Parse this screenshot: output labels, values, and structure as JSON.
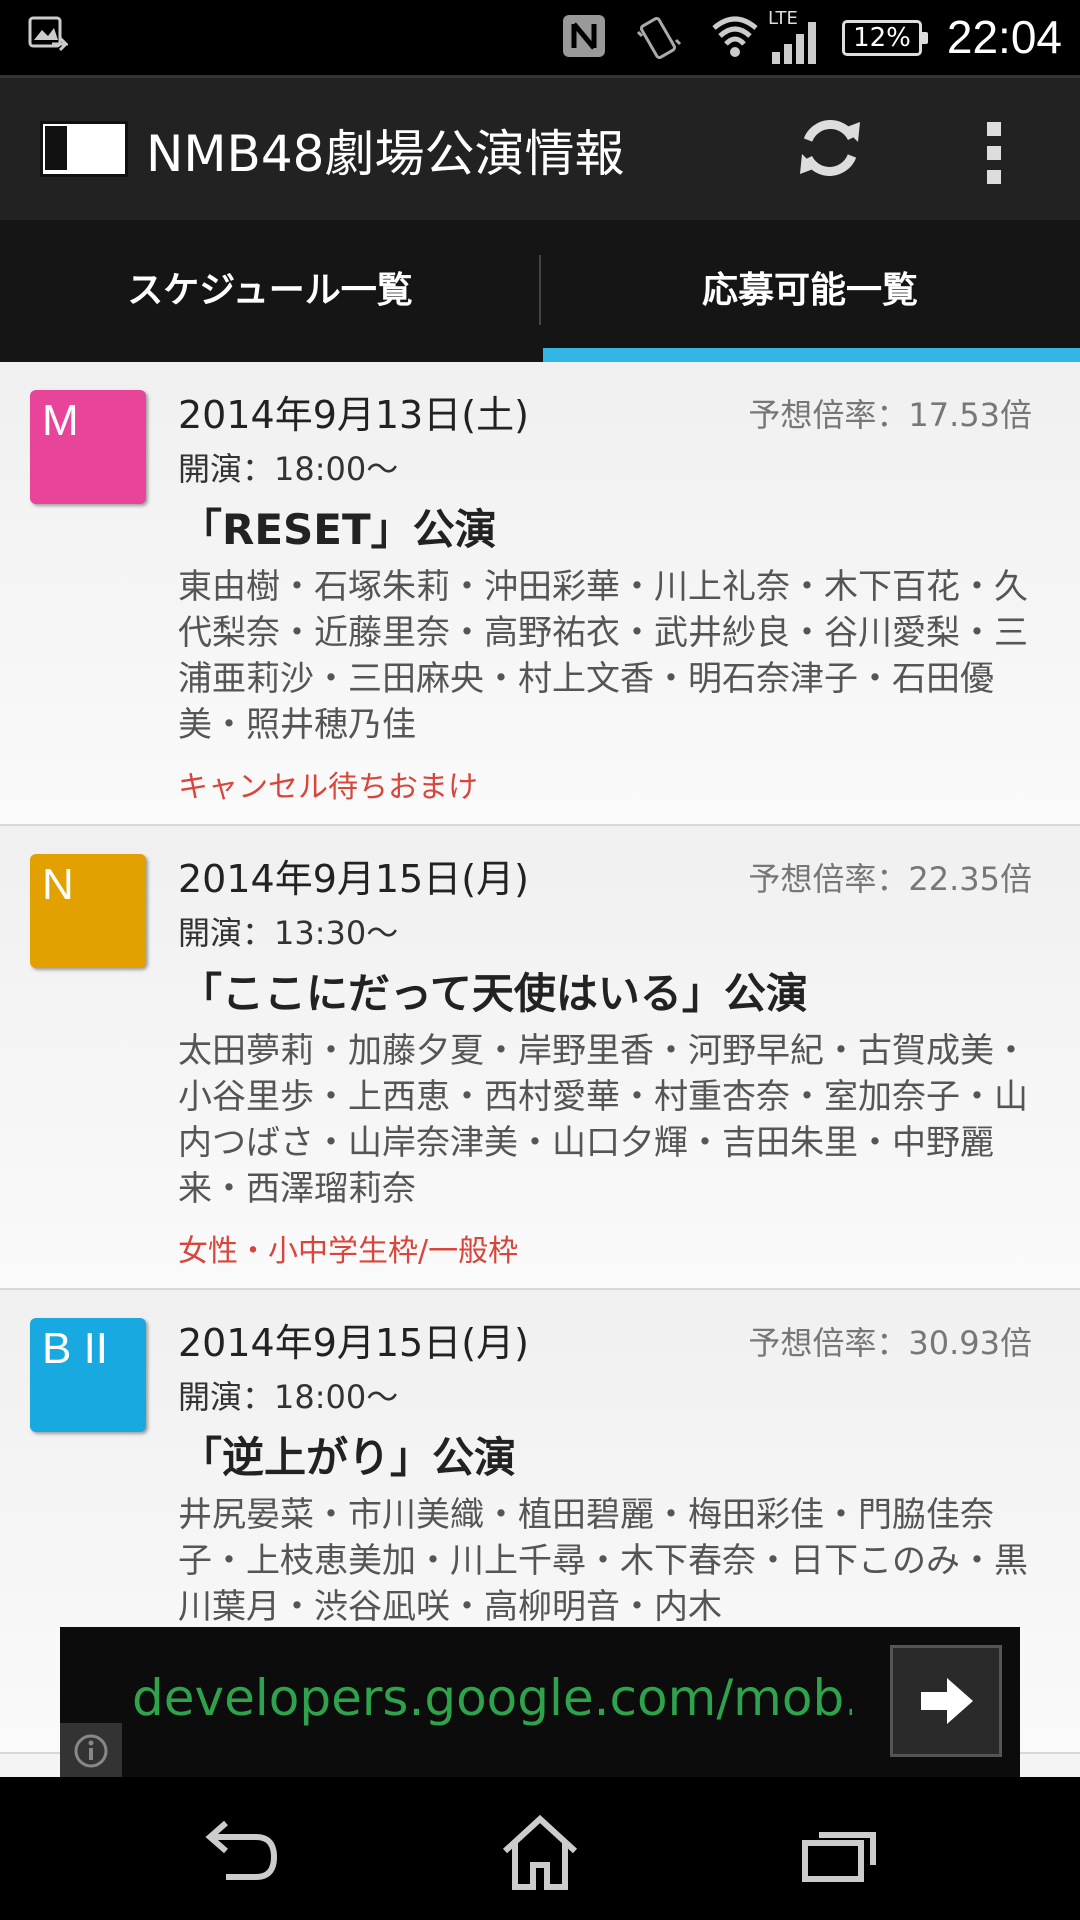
{
  "status_bar": {
    "battery": "12%",
    "time": "22:04",
    "icons": [
      "screenshot-icon",
      "nfc-icon",
      "vibrate-icon",
      "wifi-icon",
      "lte-signal-icon",
      "battery-icon"
    ],
    "lte_label": "LTE"
  },
  "action_bar": {
    "title": "NMB48劇場公演情報",
    "icons": [
      "app-logo-icon",
      "refresh-icon",
      "overflow-menu-icon"
    ]
  },
  "tabs": [
    {
      "label": "スケジュール一覧",
      "selected": false
    },
    {
      "label": "応募可能一覧",
      "selected": true
    }
  ],
  "accent_color": "#33b5e5",
  "performances": [
    {
      "team": "M",
      "team_color": "#e8449a",
      "date": "2014年9月13日(土)",
      "ratio": "予想倍率：17.53倍",
      "time": "開演：18:00～",
      "title": "「RESET」公演",
      "members": "東由樹・石塚朱莉・沖田彩華・川上礼奈・木下百花・久代梨奈・近藤里奈・高野祐衣・武井紗良・谷川愛梨・三浦亜莉沙・三田麻央・村上文香・明石奈津子・石田優美・照井穂乃佳",
      "note": "キャンセル待ちおまけ"
    },
    {
      "team": "N",
      "team_color": "#e2a100",
      "date": "2014年9月15日(月)",
      "ratio": "予想倍率：22.35倍",
      "time": "開演：13:30～",
      "title": "「ここにだって天使はいる」公演",
      "members": "太田夢莉・加藤夕夏・岸野里香・河野早紀・古賀成美・小谷里歩・上西恵・西村愛華・村重杏奈・室加奈子・山内つばさ・山岸奈津美・山口夕輝・吉田朱里・中野麗来・西澤瑠莉奈",
      "note": "女性・小中学生枠/一般枠"
    },
    {
      "team": "B II",
      "team_color": "#18a9e0",
      "date": "2014年9月15日(月)",
      "ratio": "予想倍率：30.93倍",
      "time": "開演：18:00～",
      "title": "「逆上がり」公演",
      "members": "井尻晏菜・市川美織・植田碧麗・梅田彩佳・門脇佳奈子・上枝恵美加・川上千尋・木下春奈・日下このみ・黒川葉月・渋谷凪咲・高柳明音・内木",
      "note": ""
    }
  ],
  "ad": {
    "url_text": "developers.google.com/mob..."
  },
  "nav_bar": {
    "icons": [
      "back-icon",
      "home-icon",
      "recent-apps-icon"
    ]
  }
}
